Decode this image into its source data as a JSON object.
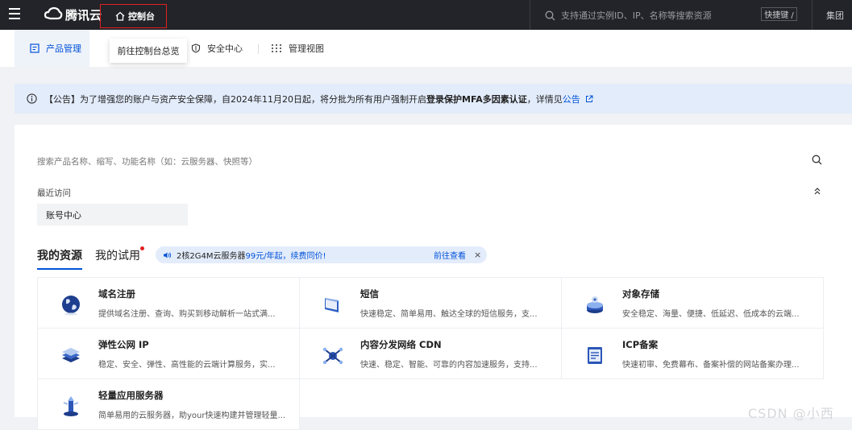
{
  "topbar": {
    "logo_text": "腾讯云",
    "console_label": "控制台",
    "search_placeholder": "支持通过实例ID、IP、名称等搜索资源",
    "shortcut_label": "快捷键 /",
    "group_label": "集团"
  },
  "tabs": [
    {
      "label": "产品管理"
    },
    {
      "label": "安全中心"
    },
    {
      "label": "管理视图"
    }
  ],
  "tooltip": "前往控制台总览",
  "notice": {
    "prefix": "【公告】为了增强您的账户与资产安全保障，自2024年11月20日起，将分批为所有用户强制开启",
    "bold": "登录保护MFA多因素认证",
    "suffix": "，详情见",
    "link": "公告"
  },
  "product_search": {
    "placeholder": "搜索产品名称、缩写、功能名称（如：云服务器、快照等）"
  },
  "recent": {
    "label": "最近访问",
    "items": [
      "账号中心"
    ]
  },
  "resource_tabs": [
    {
      "label": "我的资源"
    },
    {
      "label": "我的试用"
    }
  ],
  "promo": {
    "text_a": "2核2G4M云服务器",
    "highlight": "99元/年起，续费同价!",
    "cta": "前往查看",
    "close": "×"
  },
  "products": [
    {
      "name": "域名注册",
      "desc": "提供域名注册、查询、购买到移动解析一站式满...",
      "icon": "globe-icon"
    },
    {
      "name": "短信",
      "desc": "快速稳定、简单易用、触达全球的短信服务，支...",
      "icon": "sms-icon"
    },
    {
      "name": "对象存储",
      "desc": "安全稳定、海量、便捷、低延迟、低成本的云端...",
      "icon": "storage-icon"
    },
    {
      "name": "弹性公网 IP",
      "desc": "稳定、安全、弹性、高性能的云端计算服务，实...",
      "icon": "eip-icon"
    },
    {
      "name": "内容分发网络 CDN",
      "desc": "快速、稳定、智能、可靠的内容加速服务，支持...",
      "icon": "cdn-icon"
    },
    {
      "name": "ICP备案",
      "desc": "快速初审、免费幕布、备案补偿的网站备案办理...",
      "icon": "icp-icon"
    },
    {
      "name": "轻量应用服务器",
      "desc": "简单易用的云服务器，助your快速构建并管理轻量...",
      "icon": "lighthouse-icon"
    }
  ],
  "watermark": "CSDN @小西",
  "colors": {
    "accent": "#0052d9",
    "topbar": "#232429",
    "notice_bg": "#e3ecfb"
  }
}
